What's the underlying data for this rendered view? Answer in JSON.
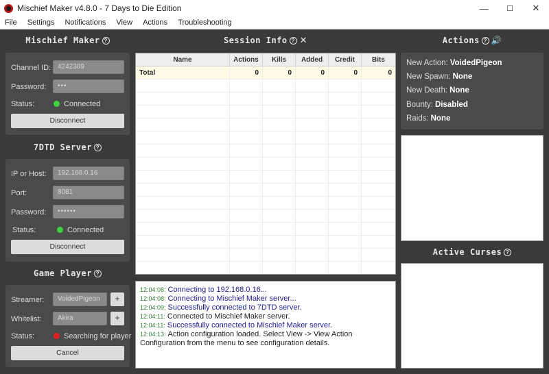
{
  "window": {
    "title": "Mischief Maker v4.8.0 - 7 Days to Die Edition",
    "minimize": "—",
    "maximize": "☐",
    "close": "✕"
  },
  "menu": [
    "File",
    "Settings",
    "Notifications",
    "View",
    "Actions",
    "Troubleshooting"
  ],
  "mischief_maker": {
    "title": "Mischief Maker",
    "channel_label": "Channel ID:",
    "channel_value": "4242389",
    "password_label": "Password:",
    "password_value": "•••",
    "status_label": "Status:",
    "status_text": "Connected",
    "button": "Disconnect"
  },
  "server": {
    "title": "7DTD Server",
    "host_label": "IP or Host:",
    "host_value": "192.168.0.16",
    "port_label": "Port:",
    "port_value": "8081",
    "password_label": "Password:",
    "password_value": "••••••",
    "status_label": "Status:",
    "status_text": "Connected",
    "button": "Disconnect"
  },
  "game_player": {
    "title": "Game Player",
    "streamer_label": "Streamer:",
    "streamer_value": "VoidedPigeon",
    "whitelist_label": "Whitelist:",
    "whitelist_value": "Akira",
    "add": "+",
    "status_label": "Status:",
    "status_text": "Searching for player",
    "button": "Cancel"
  },
  "session": {
    "title": "Session Info",
    "columns": [
      "Name",
      "Actions",
      "Kills",
      "Added",
      "Credit",
      "Bits"
    ],
    "total": {
      "name": "Total",
      "actions": "0",
      "kills": "0",
      "added": "0",
      "credit": "0",
      "bits": "0"
    }
  },
  "log": [
    {
      "ts": "12:04:08:",
      "text": "Connecting to 192.168.0.16..."
    },
    {
      "ts": "12:04:08:",
      "text": "Connecting to Mischief Maker server..."
    },
    {
      "ts": "12:04:09:",
      "text": "Successfully connected to 7DTD server."
    },
    {
      "ts": "12:04:11:",
      "text": "Connected to Mischief Maker server."
    },
    {
      "ts": "12:04:11:",
      "text": "Successfully connected to Mischief Maker server."
    },
    {
      "ts": "12:04:13:",
      "text": "Action configuration loaded. Select View -> View Action"
    },
    {
      "ts": "",
      "text": "Configuration from the menu to see configuration details."
    }
  ],
  "actions": {
    "title": "Actions",
    "new_action_label": "New Action:",
    "new_action_value": "VoidedPigeon",
    "new_spawn_label": "New Spawn:",
    "new_spawn_value": "None",
    "new_death_label": "New Death:",
    "new_death_value": "None",
    "bounty_label": "Bounty:",
    "bounty_value": "Disabled",
    "raids_label": "Raids:",
    "raids_value": "None"
  },
  "curses": {
    "title": "Active Curses"
  },
  "icons": {
    "help": "?",
    "close": "✕",
    "speaker": "🔊"
  }
}
